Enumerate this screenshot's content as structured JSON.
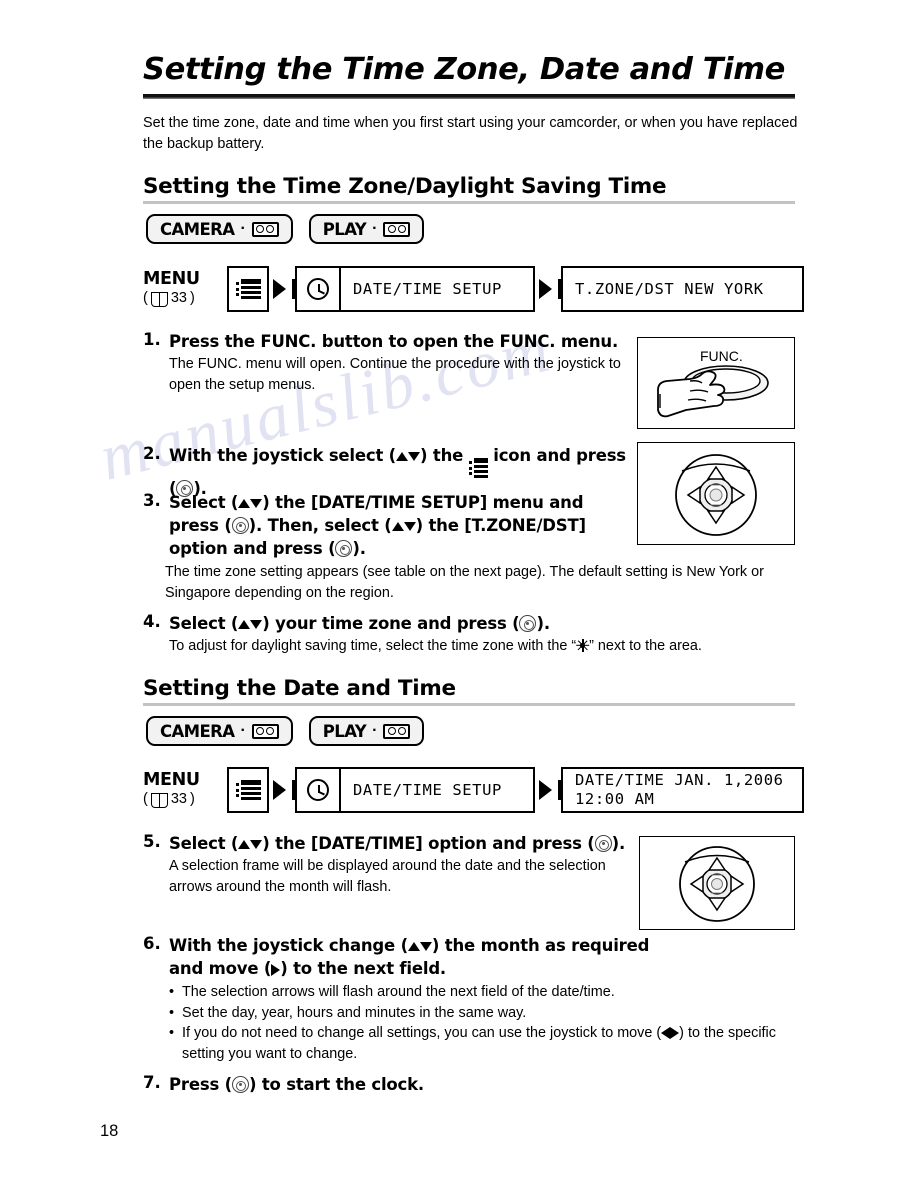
{
  "page": {
    "number": "18",
    "title": "Setting the Time Zone, Date and Time",
    "intro": "Set the time zone, date and time when you first start using your camcorder, or when you have replaced the backup battery.",
    "watermark": "manualslib.com"
  },
  "section1": {
    "heading": "Setting the Time Zone/Daylight Saving Time",
    "badges": [
      {
        "label": "CAMERA",
        "dot": "·",
        "icon": "tape-icon"
      },
      {
        "label": "PLAY",
        "dot": "·",
        "icon": "tape-icon"
      }
    ],
    "menu_flow": {
      "menu_word": "MENU",
      "page_ref_open": "(",
      "page_ref": "33",
      "page_ref_close": ")",
      "menu_icon": "menu-list-icon",
      "clock_icon": "clock-icon",
      "item_label": "DATE/TIME SETUP",
      "result_label": "T.ZONE/DST NEW YORK"
    }
  },
  "section2": {
    "heading": "Setting the Date and Time",
    "badges": [
      {
        "label": "CAMERA",
        "dot": "·",
        "icon": "tape-icon"
      },
      {
        "label": "PLAY",
        "dot": "·",
        "icon": "tape-icon"
      }
    ],
    "menu_flow": {
      "menu_word": "MENU",
      "page_ref_open": "(",
      "page_ref": "33",
      "page_ref_close": ")",
      "menu_icon": "menu-list-icon",
      "clock_icon": "clock-icon",
      "item_label": "DATE/TIME SETUP",
      "result_line1": "DATE/TIME JAN. 1,2006",
      "result_line2": "12:00 AM"
    }
  },
  "steps": {
    "s1": {
      "num": "1.",
      "title": "Press the FUNC. button to open the FUNC. menu.",
      "desc": "The FUNC. menu will open. Continue the procedure with the joystick to open the setup menus."
    },
    "s2": {
      "num": "2.",
      "t_a": "With the joystick select (",
      "t_b": ") the",
      "t_c": "icon and press",
      "t_d": "(",
      "t_e": ")."
    },
    "s3": {
      "num": "3.",
      "t_a": "Select (",
      "t_b": ") the [DATE/TIME SETUP] menu and",
      "t_c": "press (",
      "t_d": "). Then, select (",
      "t_e": ") the [T.ZONE/DST]",
      "t_f": "option and press (",
      "t_g": ").",
      "desc": "The time zone setting appears (see table on the next page). The default setting is New York or Singapore depending on the region."
    },
    "s4": {
      "num": "4.",
      "t_a": "Select (",
      "t_b": ") your time zone and press (",
      "t_c": ").",
      "desc_a": "To adjust for daylight saving time, select the time zone with the “",
      "desc_b": "” next to the area."
    },
    "s5": {
      "num": "5.",
      "t_a": "Select (",
      "t_b": ") the [DATE/TIME] option and press (",
      "t_c": ").",
      "desc": "A selection frame will be displayed around the date and the selection arrows around the month will flash."
    },
    "s6": {
      "num": "6.",
      "t_a": "With the joystick change (",
      "t_b": ") the month as required",
      "t_c": "and move (",
      "t_d": ") to the next field.",
      "bullets": [
        {
          "text": "The selection arrows will flash around the next field of the date/time."
        },
        {
          "text": "Set the day, year, hours and minutes in the same way."
        },
        {
          "text_a": "If you do not need to change all settings, you can use the joystick to move (",
          "text_b": ") to the specific setting you want to change."
        }
      ]
    },
    "s7": {
      "num": "7.",
      "t_a": "Press (",
      "t_b": ") to start the clock."
    }
  },
  "illustrations": {
    "func_button": {
      "name": "func-button-illustration",
      "label": "FUNC."
    },
    "joystick_1": {
      "name": "joystick-illustration"
    },
    "joystick_2": {
      "name": "joystick-illustration"
    }
  },
  "colors": {
    "ink": "#000000",
    "rule_light": "#c3c3c3",
    "badge_fill": "#f2f2f2",
    "watermark": "#c9cbe8"
  }
}
